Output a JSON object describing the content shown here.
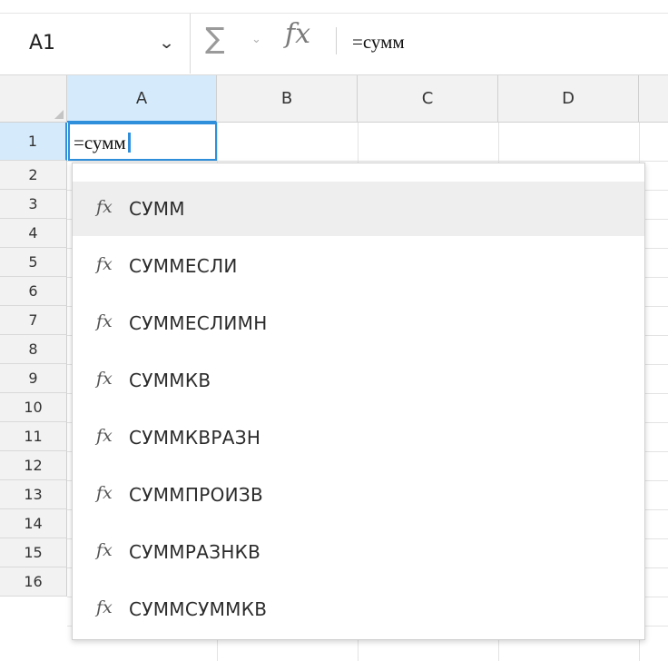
{
  "formula_bar": {
    "cell_ref": "A1",
    "formula": "=сумм"
  },
  "columns": [
    "A",
    "B",
    "C",
    "D"
  ],
  "rows": [
    "1",
    "2",
    "3",
    "4",
    "5",
    "6",
    "7",
    "8",
    "9",
    "10",
    "11",
    "12",
    "13",
    "14",
    "15",
    "16"
  ],
  "active_cell_text": "=сумм",
  "autocomplete": {
    "items": [
      "СУММ",
      "СУММЕСЛИ",
      "СУММЕСЛИМН",
      "СУММКВ",
      "СУММКВРАЗН",
      "СУММПРОИЗВ",
      "СУММРАЗНКВ",
      "СУММСУММКВ"
    ]
  }
}
